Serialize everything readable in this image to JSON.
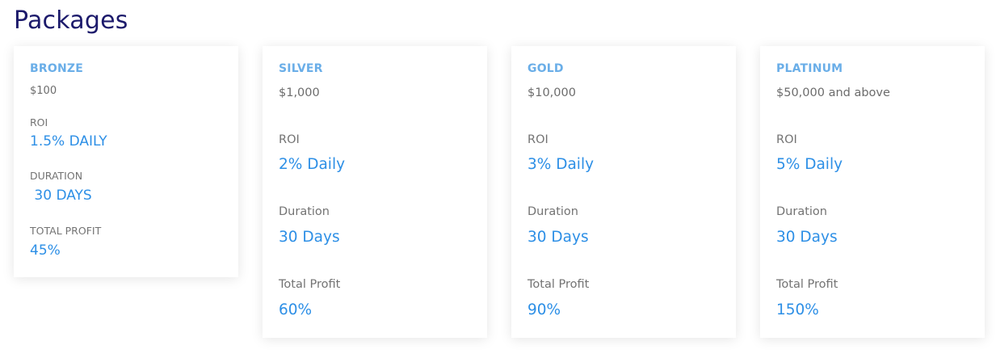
{
  "page": {
    "title": "Packages"
  },
  "packages": [
    {
      "name": "BRONZE",
      "price": "$100",
      "roi_label": "ROI",
      "roi_value": "1.5% DAILY",
      "duration_label": "DURATION",
      "duration_value": " 30 DAYS",
      "profit_label": "TOTAL PROFIT",
      "profit_value": "45%"
    },
    {
      "name": "SILVER",
      "price": "$1,000",
      "roi_label": "ROI",
      "roi_value": "2% Daily",
      "duration_label": "Duration",
      "duration_value": "30 Days",
      "profit_label": "Total Profit",
      "profit_value": "60%"
    },
    {
      "name": "GOLD",
      "price": "$10,000",
      "roi_label": "ROI",
      "roi_value": "3% Daily",
      "duration_label": "Duration",
      "duration_value": "30 Days",
      "profit_label": "Total Profit",
      "profit_value": "90%"
    },
    {
      "name": "PLATINUM",
      "price": "$50,000 and above",
      "roi_label": "ROI",
      "roi_value": "5% Daily",
      "duration_label": "Duration",
      "duration_value": "30 Days",
      "profit_label": "Total Profit",
      "profit_value": "150%"
    }
  ],
  "colors": {
    "title": "#1c1a6b",
    "package_name": "#6aaee8",
    "value": "#2d8fe6",
    "label": "#737373"
  }
}
